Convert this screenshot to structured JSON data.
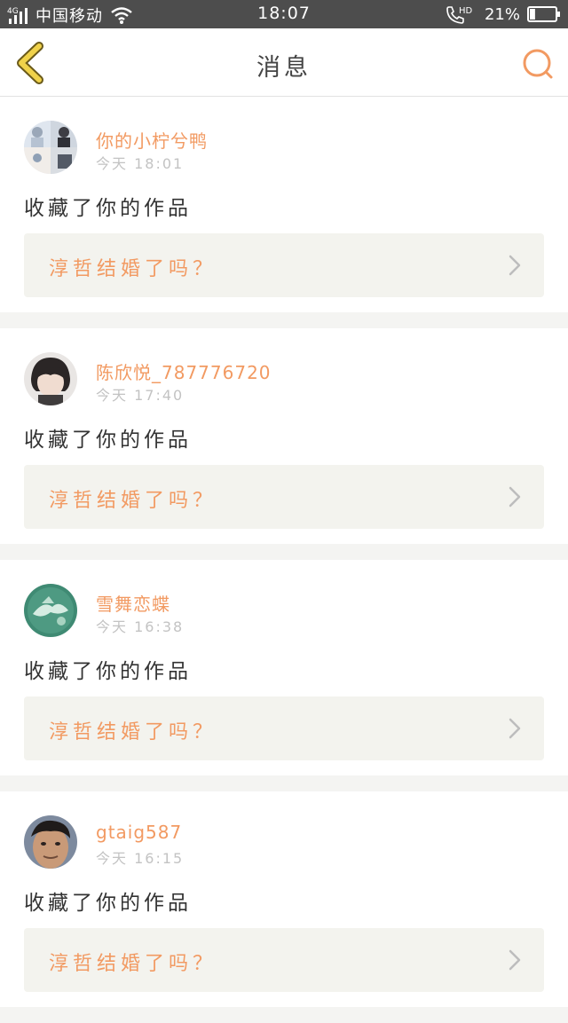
{
  "status_bar": {
    "network": "4G",
    "carrier": "中国移动",
    "time": "18:07",
    "hd_label": "HD",
    "battery_percent": "21%",
    "battery_level": 0.21
  },
  "header": {
    "title": "消息",
    "back_icon": "chevron-left-icon",
    "search_icon": "search-icon"
  },
  "colors": {
    "accent": "#f29a62",
    "back_icon": "#f0d24a",
    "work_card_bg": "#f3f3ee"
  },
  "notifications": [
    {
      "username": "你的小柠兮鸭",
      "time": "今天 18:01",
      "action": "收藏了你的作品",
      "work_title": "淳哲结婚了吗？"
    },
    {
      "username": "陈欣悦_787776720",
      "time": "今天 17:40",
      "action": "收藏了你的作品",
      "work_title": "淳哲结婚了吗？"
    },
    {
      "username": "雪舞恋蝶",
      "time": "今天 16:38",
      "action": "收藏了你的作品",
      "work_title": "淳哲结婚了吗？"
    },
    {
      "username": "gtaig587",
      "time": "今天 16:15",
      "action": "收藏了你的作品",
      "work_title": "淳哲结婚了吗？"
    }
  ]
}
